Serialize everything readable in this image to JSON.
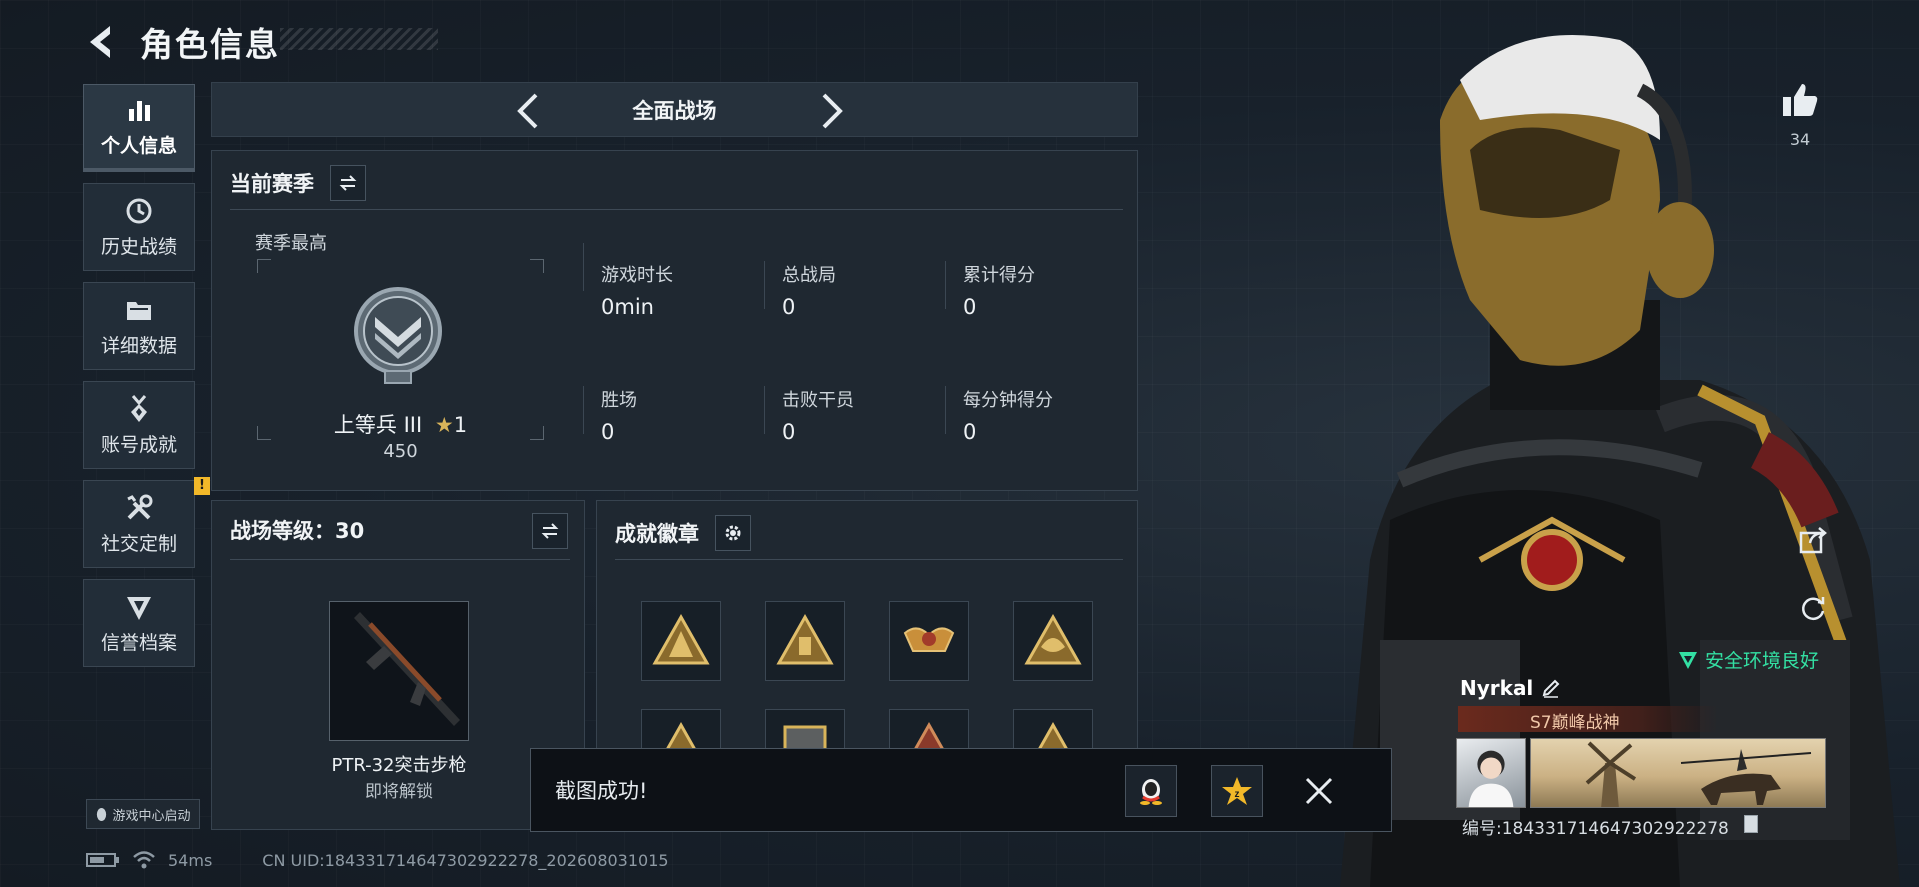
{
  "header": {
    "title": "角色信息"
  },
  "sidebar": {
    "items": [
      {
        "label": "个人信息",
        "icon": "bar-chart-icon",
        "active": true
      },
      {
        "label": "历史战绩",
        "icon": "history-icon"
      },
      {
        "label": "详细数据",
        "icon": "folder-icon"
      },
      {
        "label": "账号成就",
        "icon": "medal-icon"
      },
      {
        "label": "社交定制",
        "icon": "tools-icon",
        "badge": "!"
      },
      {
        "label": "信誉档案",
        "icon": "shield-icon"
      }
    ],
    "launch_label": "游戏中心启动"
  },
  "mode": {
    "name": "全面战场"
  },
  "season": {
    "title": "当前赛季",
    "best_label": "赛季最高",
    "rank_name": "上等兵 III",
    "rank_stars": "1",
    "rank_points": "450",
    "stats": [
      {
        "label": "游戏时长",
        "value": "0min"
      },
      {
        "label": "总战局",
        "value": "0"
      },
      {
        "label": "累计得分",
        "value": "0"
      },
      {
        "label": "胜场",
        "value": "0"
      },
      {
        "label": "击败干员",
        "value": "0"
      },
      {
        "label": "每分钟得分",
        "value": "0"
      }
    ]
  },
  "battlefield_level": {
    "title": "战场等级：30",
    "weapon_name": "PTR-32突击步枪",
    "weapon_status": "即将解锁"
  },
  "achievements": {
    "title": "成就徽章"
  },
  "toast": {
    "text": "截图成功!"
  },
  "status": {
    "ping": "54ms",
    "uid_line": "CN UID:18433171464730292227​8_202608031015"
  },
  "profile": {
    "likes": "34",
    "safety_text": "安全环境良好",
    "player_name": "Nyrkal",
    "title_text": "S7巅峰战神",
    "player_id": "编号:18433171464730292227​8"
  },
  "colors": {
    "accent": "#31e0a1",
    "gold": "#c9a14a",
    "warning": "#f2b829"
  }
}
